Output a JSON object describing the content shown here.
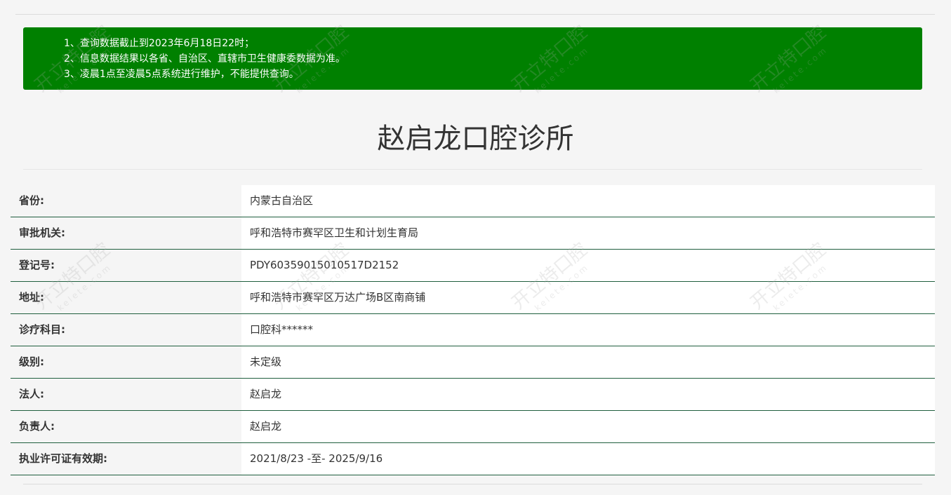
{
  "notice": {
    "lines": [
      "1、查询数据截止到2023年6月18日22时；",
      "2、信息数据结果以各省、自治区、直辖市卫生健康委数据为准。",
      "3、凌晨1点至凌晨5点系统进行维护，不能提供查询。"
    ]
  },
  "page_title": "赵启龙口腔诊所",
  "details": [
    {
      "label": "省份:",
      "value": "内蒙古自治区"
    },
    {
      "label": "审批机关:",
      "value": "呼和浩特市赛罕区卫生和计划生育局"
    },
    {
      "label": "登记号:",
      "value": "PDY60359015010517D2152"
    },
    {
      "label": "地址:",
      "value": "呼和浩特市赛罕区万达广场B区南商铺"
    },
    {
      "label": "诊疗科目:",
      "value": "口腔科******"
    },
    {
      "label": "级别:",
      "value": "未定级"
    },
    {
      "label": "法人:",
      "value": "赵启龙"
    },
    {
      "label": "负责人:",
      "value": "赵启龙"
    },
    {
      "label": "执业许可证有效期:",
      "value": "2021/8/23 -至- 2025/9/16"
    }
  ],
  "watermark": {
    "brand": "开立特口腔",
    "domain": "kelete.com"
  },
  "colors": {
    "notice_bg": "#008000",
    "row_border": "#1f5e3e"
  }
}
